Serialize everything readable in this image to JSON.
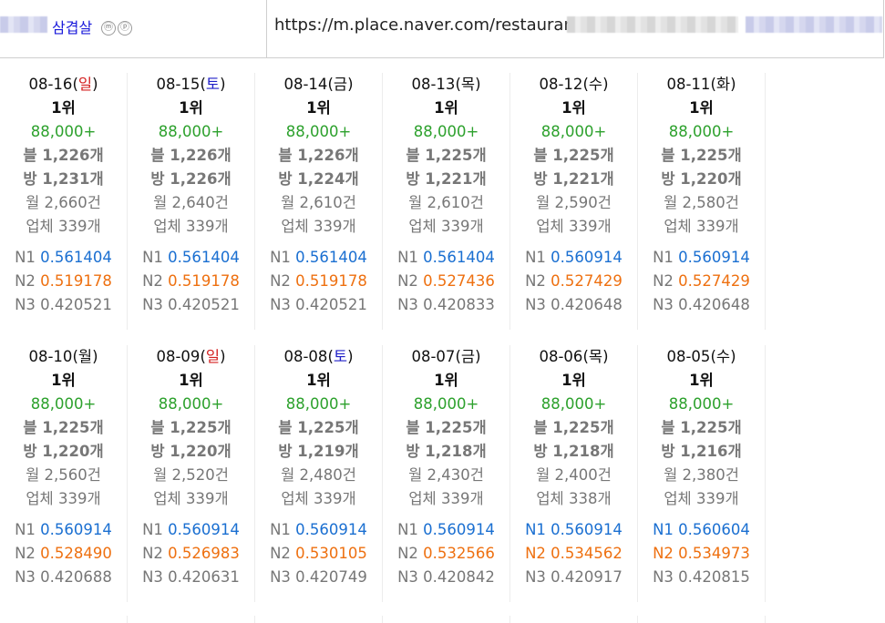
{
  "header": {
    "keyword": "삼겹살",
    "icon_m": "ⓜ",
    "icon_p": "ⓟ",
    "url": "https://m.place.naver.com/restaurant/"
  },
  "labels": {
    "n1": "N1",
    "n2": "N2",
    "n3": "N3"
  },
  "colors": {
    "search": "#2da12d",
    "n1": "#1a6fd1",
    "n2": "#ee7010",
    "sunday": "#d42020",
    "saturday": "#2020c8",
    "link": "#1a1adb"
  },
  "days": [
    {
      "date": "08-16",
      "wd": "일",
      "rank": "1위",
      "search": "88,000+",
      "blog": "블 1,226개",
      "visit": "방 1,231개",
      "month": "월 2,660건",
      "biz": "업체 339개",
      "n1": "0.561404",
      "n2": "0.519178",
      "n3": "N3 0.420521"
    },
    {
      "date": "08-15",
      "wd": "토",
      "rank": "1위",
      "search": "88,000+",
      "blog": "블 1,226개",
      "visit": "방 1,226개",
      "month": "월 2,640건",
      "biz": "업체 339개",
      "n1": "0.561404",
      "n2": "0.519178",
      "n3": "N3 0.420521"
    },
    {
      "date": "08-14",
      "wd": "금",
      "rank": "1위",
      "search": "88,000+",
      "blog": "블 1,226개",
      "visit": "방 1,224개",
      "month": "월 2,610건",
      "biz": "업체 339개",
      "n1": "0.561404",
      "n2": "0.519178",
      "n3": "N3 0.420521"
    },
    {
      "date": "08-13",
      "wd": "목",
      "rank": "1위",
      "search": "88,000+",
      "blog": "블 1,225개",
      "visit": "방 1,221개",
      "month": "월 2,610건",
      "biz": "업체 339개",
      "n1": "0.561404",
      "n2": "0.527436",
      "n3": "N3 0.420833"
    },
    {
      "date": "08-12",
      "wd": "수",
      "rank": "1위",
      "search": "88,000+",
      "blog": "블 1,225개",
      "visit": "방 1,221개",
      "month": "월 2,590건",
      "biz": "업체 339개",
      "n1": "0.560914",
      "n2": "0.527429",
      "n3": "N3 0.420648"
    },
    {
      "date": "08-11",
      "wd": "화",
      "rank": "1위",
      "search": "88,000+",
      "blog": "블 1,225개",
      "visit": "방 1,220개",
      "month": "월 2,580건",
      "biz": "업체 339개",
      "n1": "0.560914",
      "n2": "0.527429",
      "n3": "N3 0.420648"
    },
    {
      "date": "08-10",
      "wd": "월",
      "rank": "1위",
      "search": "88,000+",
      "blog": "블 1,225개",
      "visit": "방 1,220개",
      "month": "월 2,560건",
      "biz": "업체 339개",
      "n1": "0.560914",
      "n2": "0.528490",
      "n3": "N3 0.420688"
    },
    {
      "date": "08-09",
      "wd": "일",
      "rank": "1위",
      "search": "88,000+",
      "blog": "블 1,225개",
      "visit": "방 1,220개",
      "month": "월 2,520건",
      "biz": "업체 339개",
      "n1": "0.560914",
      "n2": "0.526983",
      "n3": "N3 0.420631"
    },
    {
      "date": "08-08",
      "wd": "토",
      "rank": "1위",
      "search": "88,000+",
      "blog": "블 1,225개",
      "visit": "방 1,219개",
      "month": "월 2,480건",
      "biz": "업체 339개",
      "n1": "0.560914",
      "n2": "0.530105",
      "n3": "N3 0.420749"
    },
    {
      "date": "08-07",
      "wd": "금",
      "rank": "1위",
      "search": "88,000+",
      "blog": "블 1,225개",
      "visit": "방 1,218개",
      "month": "월 2,430건",
      "biz": "업체 339개",
      "n1": "0.560914",
      "n2": "0.532566",
      "n3": "N3 0.420842"
    },
    {
      "date": "08-06",
      "wd": "목",
      "rank": "1위",
      "search": "88,000+",
      "blog": "블 1,225개",
      "visit": "방 1,218개",
      "month": "월 2,400건",
      "biz": "업체 338개",
      "n1": "0.560914",
      "n2": "0.534562",
      "n3": "N3 0.420917"
    },
    {
      "date": "08-05",
      "wd": "수",
      "rank": "1위",
      "search": "88,000+",
      "blog": "블 1,225개",
      "visit": "방 1,216개",
      "month": "월 2,380건",
      "biz": "업체 339개",
      "n1": "0.560604",
      "n2": "0.534973",
      "n3": "N3 0.420815"
    }
  ]
}
